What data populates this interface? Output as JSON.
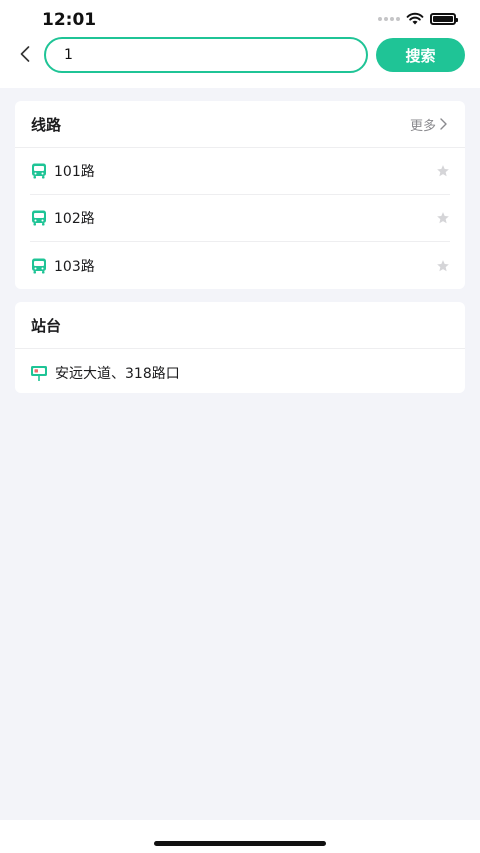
{
  "status_bar": {
    "time": "12:01"
  },
  "search": {
    "value": "1",
    "button_label": "搜索"
  },
  "lines_section": {
    "title": "线路",
    "more_label": "更多",
    "items": [
      {
        "label": "101路"
      },
      {
        "label": "102路"
      },
      {
        "label": "103路"
      }
    ]
  },
  "stops_section": {
    "title": "站台",
    "items": [
      {
        "label": "安远大道、318路口"
      }
    ]
  },
  "colors": {
    "accent": "#1fc496",
    "background": "#f3f4f9",
    "card": "#ffffff"
  }
}
